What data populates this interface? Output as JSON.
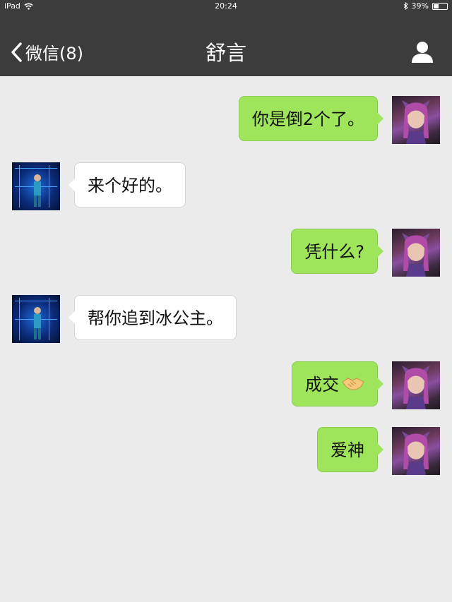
{
  "status_bar": {
    "device": "iPad",
    "time": "20:24",
    "battery": "39%",
    "battery_level": 0.39
  },
  "nav": {
    "back_label": "微信(8)",
    "title": "舒言"
  },
  "messages": [
    {
      "side": "right",
      "text": "你是倒2个了。"
    },
    {
      "side": "left",
      "text": "来个好的。"
    },
    {
      "side": "right",
      "text": "凭什么?"
    },
    {
      "side": "left",
      "text": "帮你追到冰公主。"
    },
    {
      "side": "right",
      "text": "成交",
      "emoji": "handshake"
    },
    {
      "side": "right",
      "text": "爱神"
    }
  ],
  "colors": {
    "nav_bg": "#3c3c3c",
    "chat_bg": "#ebebeb",
    "outgoing_bubble": "#9fe55c",
    "incoming_bubble": "#ffffff"
  }
}
